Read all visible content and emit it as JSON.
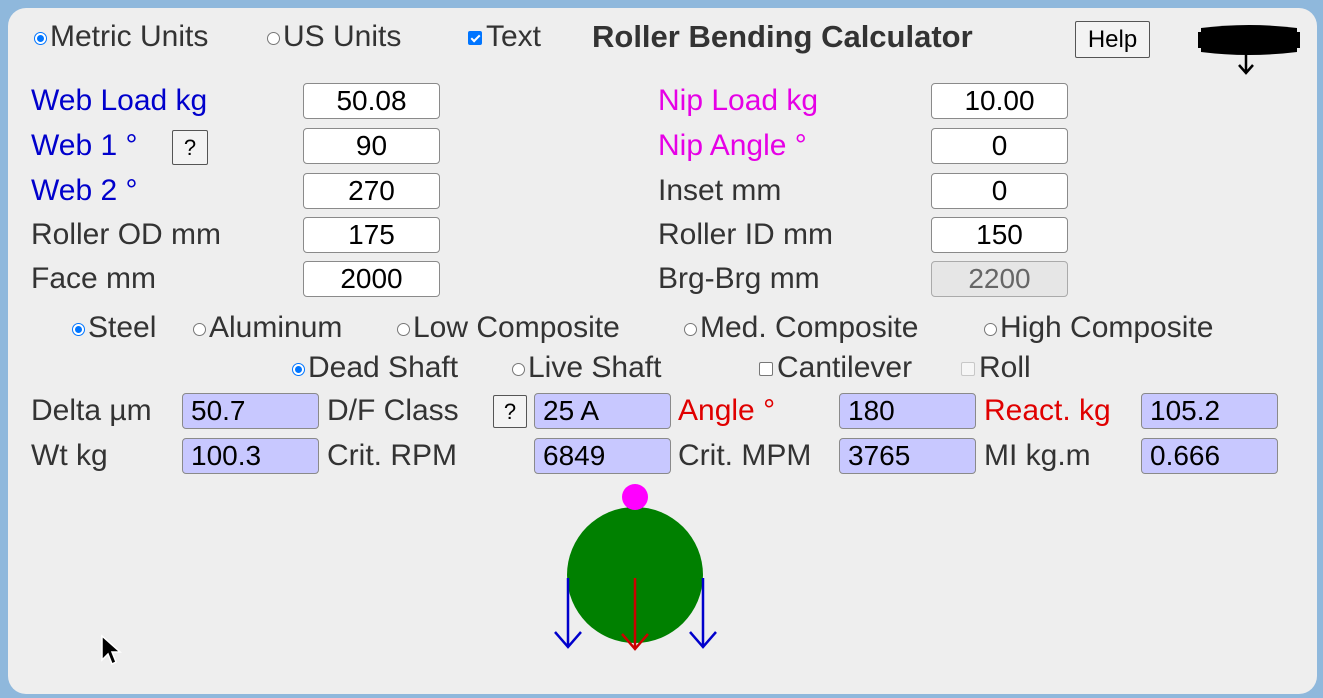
{
  "header": {
    "units_metric": "Metric Units",
    "units_us": "US Units",
    "text_toggle": "Text",
    "title": "Roller Bending Calculator",
    "help": "Help"
  },
  "inputs_left": [
    {
      "label": "Web Load kg",
      "value": "50.08"
    },
    {
      "label": "Web 1 °",
      "value": "90"
    },
    {
      "label": "Web 2 °",
      "value": "270"
    },
    {
      "label": "Roller OD mm",
      "value": "175"
    },
    {
      "label": "Face mm",
      "value": "2000"
    }
  ],
  "inputs_right": [
    {
      "label": "Nip Load kg",
      "value": "10.00"
    },
    {
      "label": "Nip Angle °",
      "value": "0"
    },
    {
      "label": "Inset mm",
      "value": "0"
    },
    {
      "label": "Roller ID mm",
      "value": "150"
    },
    {
      "label": "Brg-Brg mm",
      "value": "2200"
    }
  ],
  "help_q": "?",
  "materials": [
    "Steel",
    "Aluminum",
    "Low Composite",
    "Med. Composite",
    "High Composite"
  ],
  "shaft": {
    "dead": "Dead Shaft",
    "live": "Live Shaft",
    "cantilever": "Cantilever",
    "roll": "Roll"
  },
  "results": {
    "delta_label": "Delta µm",
    "delta_value": "50.7",
    "df_label": "D/F Class",
    "df_value": "25 A",
    "angle_label": "Angle °",
    "angle_value": "180",
    "react_label": "React. kg",
    "react_value": "105.2",
    "wt_label": "Wt kg",
    "wt_value": "100.3",
    "rpm_label": "Crit. RPM",
    "rpm_value": "6849",
    "mpm_label": "Crit. MPM",
    "mpm_value": "3765",
    "mi_label": "MI kg.m",
    "mi_value": "0.666"
  },
  "colors": {
    "web_label": "#0000cc",
    "nip_label": "#e600e6",
    "reaction_label": "#e00000",
    "output_bg": "#c8c8ff",
    "roller": "#008000",
    "nip_dot": "#ff00ff",
    "web_arrows": "#0000cc",
    "reaction_arrow": "#cc0000"
  }
}
